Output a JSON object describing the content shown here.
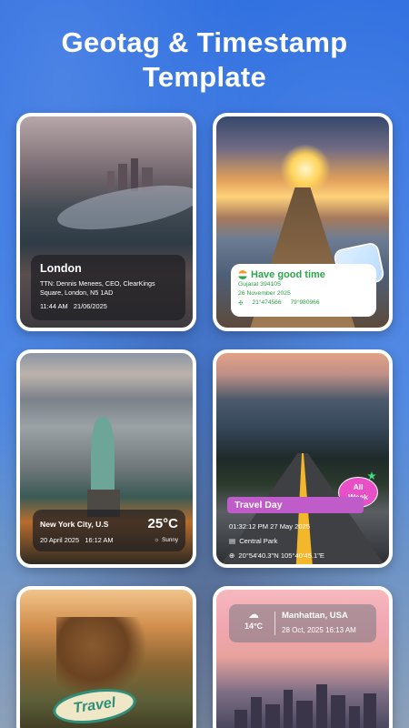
{
  "title_line1": "Geotag & Timestamp",
  "title_line2": "Template",
  "cards": {
    "london": {
      "city": "London",
      "address": "TTN: Dennis Menees, CEO, ClearKings Square, London, N5 1AD",
      "time": "11:44 AM",
      "date": "21/06/2025"
    },
    "sunset": {
      "title": "Have good time",
      "location": "Gujarat 394105",
      "date": "26 November 2025",
      "lat": "21°474566",
      "lon": "79°980966"
    },
    "newyork": {
      "city": "New York City, U.S",
      "date": "20 April 2025",
      "time": "16:12 AM",
      "temp": "25°C",
      "weather": "Sunny"
    },
    "travel": {
      "tag": "Travel Day",
      "badge_line1": "All",
      "badge_line2": "Week",
      "datetime": "01:32:12 PM 27 May 2025",
      "place": "Central Park",
      "coords": "20°54'40.3\"N 105°40'45.1\"E"
    },
    "lion": {
      "badge": "Travel"
    },
    "manhattan": {
      "temp": "14°C",
      "city": "Manhattan, USA",
      "datetime": "28 Oct, 2025 16:13 AM"
    }
  },
  "colors": {
    "background": "#2f6fe0",
    "green_text": "#2aa64b",
    "travel_tag": "#c05cc9",
    "all_week_badge": "#e94fc7"
  }
}
